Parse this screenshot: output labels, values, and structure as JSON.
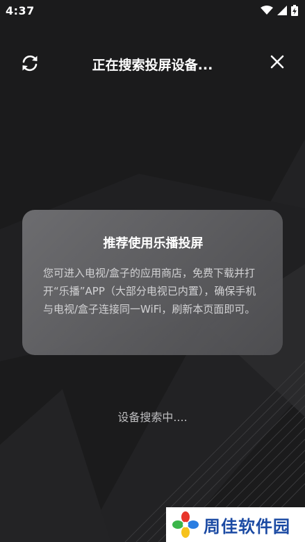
{
  "status_bar": {
    "time": "4:37",
    "icons": [
      "wifi-icon",
      "signal-icon",
      "battery-icon"
    ]
  },
  "header": {
    "title": "正在搜索投屏设备...",
    "refresh_icon": "refresh-icon",
    "close_icon": "close-icon"
  },
  "card": {
    "title": "推荐使用乐播投屏",
    "body": "您可进入电视/盒子的应用商店，免费下载并打开“乐播”APP（大部分电视已内置），确保手机与电视/盒子连接同一WiFi，刷新本页面即可。"
  },
  "status": {
    "searching": "设备搜索中...."
  },
  "watermark": {
    "text": "周佳软件园"
  },
  "colors": {
    "background": "#1a1a1b",
    "card": "#6a6a6d",
    "watermark_text": "#1b4aa3"
  }
}
